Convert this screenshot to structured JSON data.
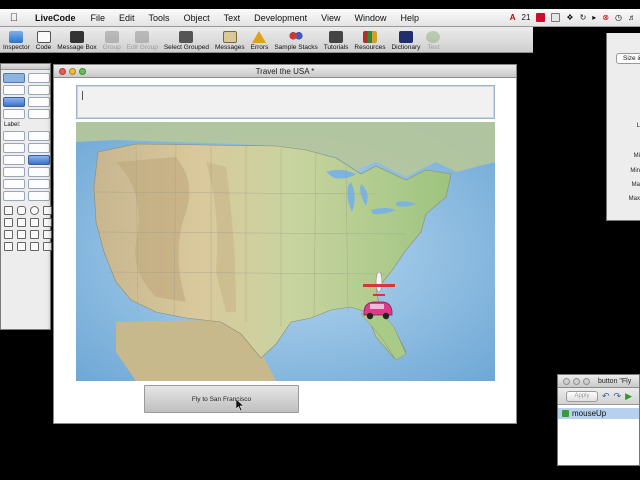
{
  "menubar": {
    "app_name": "LiveCode",
    "items": [
      "File",
      "Edit",
      "Tools",
      "Object",
      "Text",
      "Development",
      "View",
      "Window",
      "Help"
    ],
    "status_number": "21"
  },
  "toolbar": {
    "items": [
      {
        "label": "Inspector",
        "icon": "inspector-icon",
        "disabled": false,
        "color": "#2d73c8"
      },
      {
        "label": "Code",
        "icon": "code-icon",
        "disabled": false,
        "color": "#4a4a4a"
      },
      {
        "label": "Message Box",
        "icon": "message-box-icon",
        "disabled": false,
        "color": "#333333"
      },
      {
        "label": "Group",
        "icon": "group-icon",
        "disabled": true,
        "color": "#666666"
      },
      {
        "label": "Edit Group",
        "icon": "edit-group-icon",
        "disabled": true,
        "color": "#666666"
      },
      {
        "label": "Select Grouped",
        "icon": "select-grouped-icon",
        "disabled": false,
        "color": "#555555"
      },
      {
        "label": "Messages",
        "icon": "messages-icon",
        "disabled": false,
        "color": "#7a6a3a"
      },
      {
        "label": "Errors",
        "icon": "errors-icon",
        "disabled": false,
        "color": "#e0a21a"
      },
      {
        "label": "Sample Stacks",
        "icon": "sample-stacks-icon",
        "disabled": false,
        "color": "#c83a3a"
      },
      {
        "label": "Tutorials",
        "icon": "tutorials-icon",
        "disabled": false,
        "color": "#444444"
      },
      {
        "label": "Resources",
        "icon": "resources-icon",
        "disabled": false,
        "color": "#b0302a"
      },
      {
        "label": "Dictionary",
        "icon": "dictionary-icon",
        "disabled": false,
        "color": "#1f2f6e"
      },
      {
        "label": "Test",
        "icon": "test-icon",
        "disabled": true,
        "color": "#6a9a4a"
      }
    ]
  },
  "palette": {
    "label_text": "Label:"
  },
  "stack": {
    "title": "Travel the USA *",
    "fly_button_label": "Fly to San Francisco"
  },
  "inspector": {
    "size_tab": "Size &",
    "labels": [
      "L",
      "Mi",
      "Min",
      "Ma",
      "Max"
    ]
  },
  "script_editor": {
    "title": "button \"Fly",
    "apply_label": "Apply",
    "handler": "mouseUp"
  }
}
